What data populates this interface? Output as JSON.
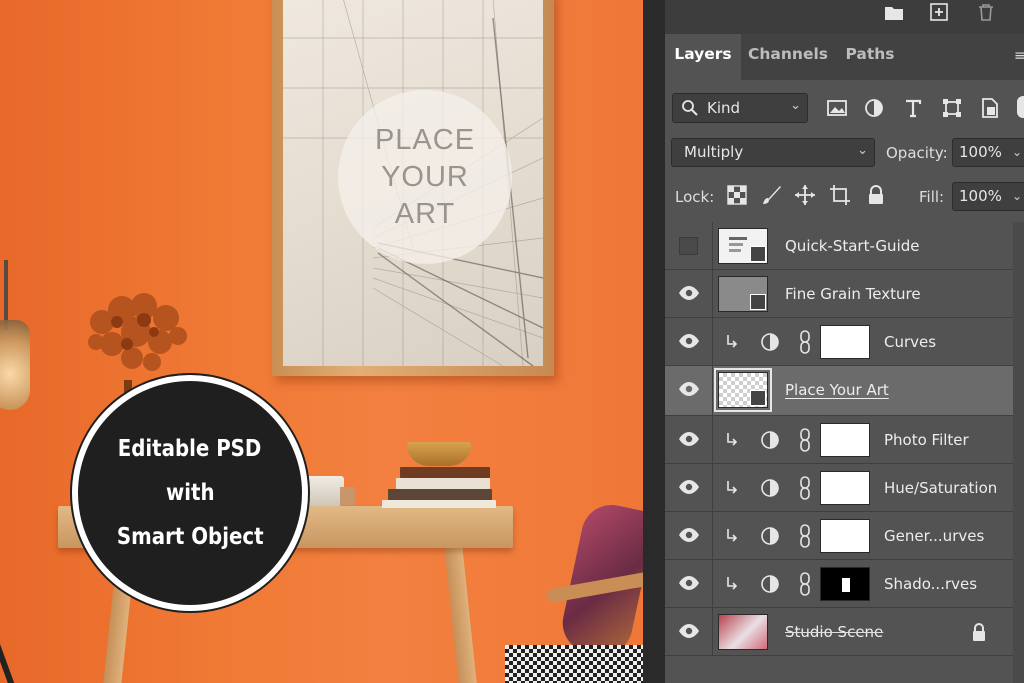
{
  "mockup": {
    "art_placeholder_lines": [
      "PLACE",
      "YOUR",
      "ART"
    ],
    "badge_lines": [
      "Editable PSD",
      "with",
      "Smart Object"
    ],
    "wall_color": "#f07a35"
  },
  "panel": {
    "tabs": [
      "Layers",
      "Channels",
      "Paths"
    ],
    "active_tab": "Layers",
    "filter": {
      "kind_label": "Kind",
      "icons": [
        "image-filter-icon",
        "adjustment-filter-icon",
        "type-filter-icon",
        "shape-filter-icon",
        "smart-object-filter-icon"
      ]
    },
    "blend_mode": "Multiply",
    "opacity_label": "Opacity:",
    "opacity_value": "100%",
    "lock_label": "Lock:",
    "fill_label": "Fill:",
    "fill_value": "100%",
    "top_icons": [
      "new-group-icon",
      "new-layer-icon",
      "trash-icon"
    ]
  },
  "layers": [
    {
      "name": "Quick-Start-Guide",
      "visible": false,
      "type": "smart-object"
    },
    {
      "name": "Fine Grain Texture",
      "visible": true,
      "type": "smart-object"
    },
    {
      "name": "Curves",
      "visible": true,
      "type": "adjustment"
    },
    {
      "name": "Place Your Art",
      "visible": true,
      "type": "smart-object",
      "selected": true
    },
    {
      "name": "Photo Filter",
      "visible": true,
      "type": "adjustment"
    },
    {
      "name": "Hue/Saturation",
      "visible": true,
      "type": "adjustment"
    },
    {
      "name": "Gener...urves",
      "visible": true,
      "type": "adjustment"
    },
    {
      "name": "Shado...rves",
      "visible": true,
      "type": "adjustment"
    },
    {
      "name": "Studio Scene",
      "visible": true,
      "type": "image",
      "locked": true
    }
  ]
}
